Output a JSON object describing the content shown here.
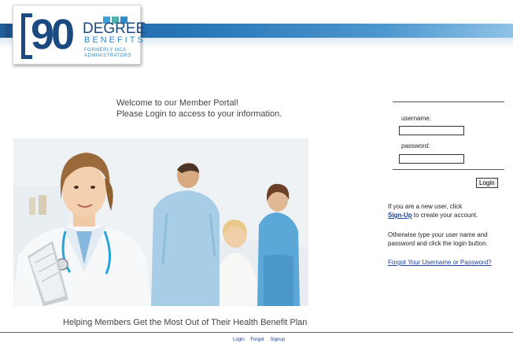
{
  "logo": {
    "number": "90",
    "word_top": "DEGREE",
    "word_bottom": "BENEFITS",
    "tagline_1": "FORMERLY MCA",
    "tagline_2": "ADMINISTRATORS",
    "colors": {
      "navy": "#1b4a80",
      "blue": "#2f8acb",
      "teal": "#4db3a8",
      "light_blue": "#3a9ed8"
    }
  },
  "welcome": {
    "line1": "Welcome to our Member Portal!",
    "line2": "Please Login to access to your information."
  },
  "hero": {
    "tagline": "Helping Members Get the Most Out of Their Health Benefit Plan"
  },
  "login": {
    "username_label": "username:",
    "username_value": "",
    "password_label": "password:",
    "password_value": "",
    "button_label": "Login"
  },
  "info": {
    "new_user_prefix": "If you are a new user, click",
    "signup_link": "Sign-Up",
    "new_user_suffix": "to create your account.",
    "otherwise_line1": "Otherwise type your user name and",
    "otherwise_line2": "password and click the login button.",
    "forgot_link": "Forgot Your Username or Password?"
  },
  "footer": {
    "links": [
      "Login",
      "Forgot",
      "Signup"
    ]
  },
  "colors": {
    "header_band": "#2a78b8",
    "link": "#1a3f9e"
  }
}
